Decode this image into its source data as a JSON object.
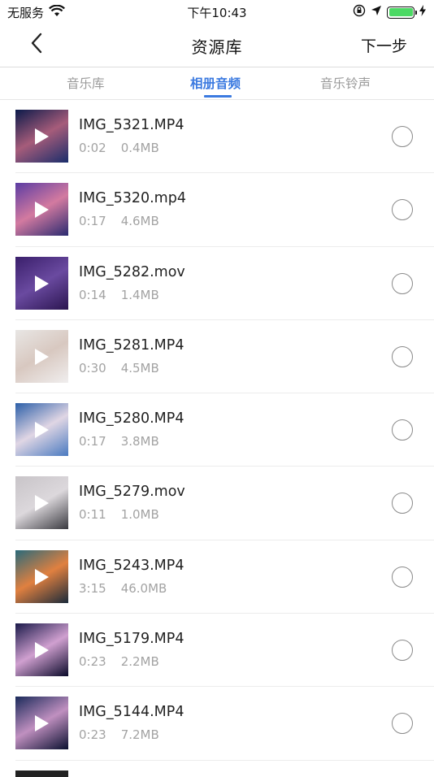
{
  "status_bar": {
    "carrier": "无服务",
    "time": "下午10:43",
    "icons": [
      "wifi-icon",
      "orientation-lock-icon",
      "location-icon",
      "battery-icon",
      "charging-icon"
    ]
  },
  "nav": {
    "back_icon": "chevron-left-icon",
    "title": "资源库",
    "next_label": "下一步"
  },
  "tabs": [
    {
      "label": "音乐库",
      "active": false
    },
    {
      "label": "相册音频",
      "active": true
    },
    {
      "label": "音乐铃声",
      "active": false
    }
  ],
  "colors": {
    "accent": "#3b7ae0",
    "battery": "#4cd964",
    "secondary_text": "#a3a3a3"
  },
  "files": [
    {
      "name": "IMG_5321.MP4",
      "duration": "0:02",
      "size": "0.4MB",
      "thumb_colors": [
        "#0b1a4a",
        "#a65c7a",
        "#1a2d6b"
      ]
    },
    {
      "name": "IMG_5320.mp4",
      "duration": "0:17",
      "size": "4.6MB",
      "thumb_colors": [
        "#5b3ca3",
        "#d37aa0",
        "#2a2a70"
      ]
    },
    {
      "name": "IMG_5282.mov",
      "duration": "0:14",
      "size": "1.4MB",
      "thumb_colors": [
        "#3a1f6b",
        "#6a4aa0",
        "#2b1550"
      ]
    },
    {
      "name": "IMG_5281.MP4",
      "duration": "0:30",
      "size": "4.5MB",
      "thumb_colors": [
        "#e8e6e4",
        "#d8c8c0",
        "#f0eeee"
      ]
    },
    {
      "name": "IMG_5280.MP4",
      "duration": "0:17",
      "size": "3.8MB",
      "thumb_colors": [
        "#2c5fa8",
        "#e0d6e4",
        "#4a7ac0"
      ]
    },
    {
      "name": "IMG_5279.mov",
      "duration": "0:11",
      "size": "1.0MB",
      "thumb_colors": [
        "#c8c4c8",
        "#dcd8dc",
        "#3a3a40"
      ]
    },
    {
      "name": "IMG_5243.MP4",
      "duration": "3:15",
      "size": "46.0MB",
      "thumb_colors": [
        "#2a6a7a",
        "#e08040",
        "#1a2a3a"
      ]
    },
    {
      "name": "IMG_5179.MP4",
      "duration": "0:23",
      "size": "2.2MB",
      "thumb_colors": [
        "#1a1a4a",
        "#d0a0d0",
        "#0a0a2a"
      ]
    },
    {
      "name": "IMG_5144.MP4",
      "duration": "0:23",
      "size": "7.2MB",
      "thumb_colors": [
        "#1a2a5a",
        "#c090c0",
        "#0a1030"
      ]
    }
  ]
}
